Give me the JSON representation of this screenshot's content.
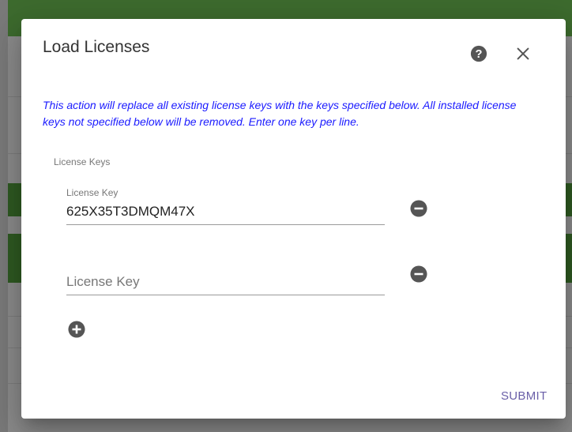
{
  "dialog": {
    "title": "Load Licenses",
    "notice": "This action will replace all existing license keys with the keys specified below. All installed license keys not specified below will be removed. Enter one key per line.",
    "section_label": "License Keys",
    "fields": [
      {
        "label": "License Key",
        "value": "625X35T3DMQM47X",
        "placeholder": ""
      },
      {
        "label": "",
        "value": "",
        "placeholder": "License Key"
      }
    ],
    "submit_label": "SUBMIT",
    "icons": {
      "help": "help-circle-icon",
      "close": "close-icon",
      "remove": "minus-circle-icon",
      "add": "plus-circle-icon"
    }
  },
  "colors": {
    "notice_text": "#1a1aff",
    "submit_text": "#6a5fa8",
    "icon_dark": "#555555",
    "background_green": "#3d6b2e"
  }
}
